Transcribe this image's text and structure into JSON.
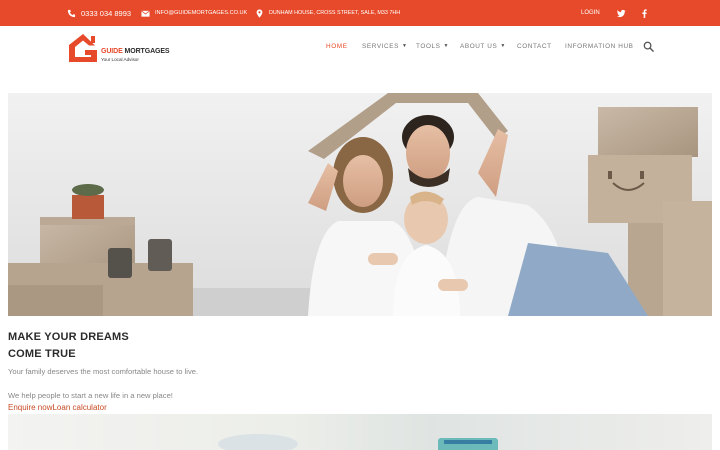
{
  "topbar": {
    "phone": "0333 034 8993",
    "email": "INFO@GUIDEMORTGAGES.CO.UK",
    "address": "DUNHAM HOUSE, CROSS STREET, SALE, M33 7HH",
    "login": "LOGIN",
    "icons": [
      "phone-icon",
      "email-icon",
      "map-pin-icon",
      "twitter-icon",
      "facebook-icon"
    ]
  },
  "brand": {
    "name_part1": "GUIDE",
    "name_part2": " MORTGAGES",
    "tagline": "Your Local Advisor",
    "accent": "#e64a2a"
  },
  "nav": {
    "items": [
      {
        "label": "HOME",
        "active": true
      },
      {
        "label": "SERVICES",
        "dropdown": true
      },
      {
        "label": "TOOLS",
        "dropdown": true
      },
      {
        "label": "ABOUT US",
        "dropdown": true
      },
      {
        "label": "CONTACT"
      },
      {
        "label": "INFORMATION HUB"
      }
    ],
    "search_icon": "search-icon"
  },
  "hero": {
    "headline_line1": "MAKE YOUR DREAMS",
    "headline_line2": "COME TRUE",
    "paragraph1": "Your family deserves the most comfortable house to live.",
    "paragraph2": "We help people to start a new life in a new place!",
    "link_enquire": "Enquire now",
    "link_calculator": "Loan calculator"
  },
  "colors": {
    "topbar_bg": "#e64a2a",
    "link": "#c84a24",
    "heading": "#2b2b2b",
    "body_text": "#888888"
  }
}
